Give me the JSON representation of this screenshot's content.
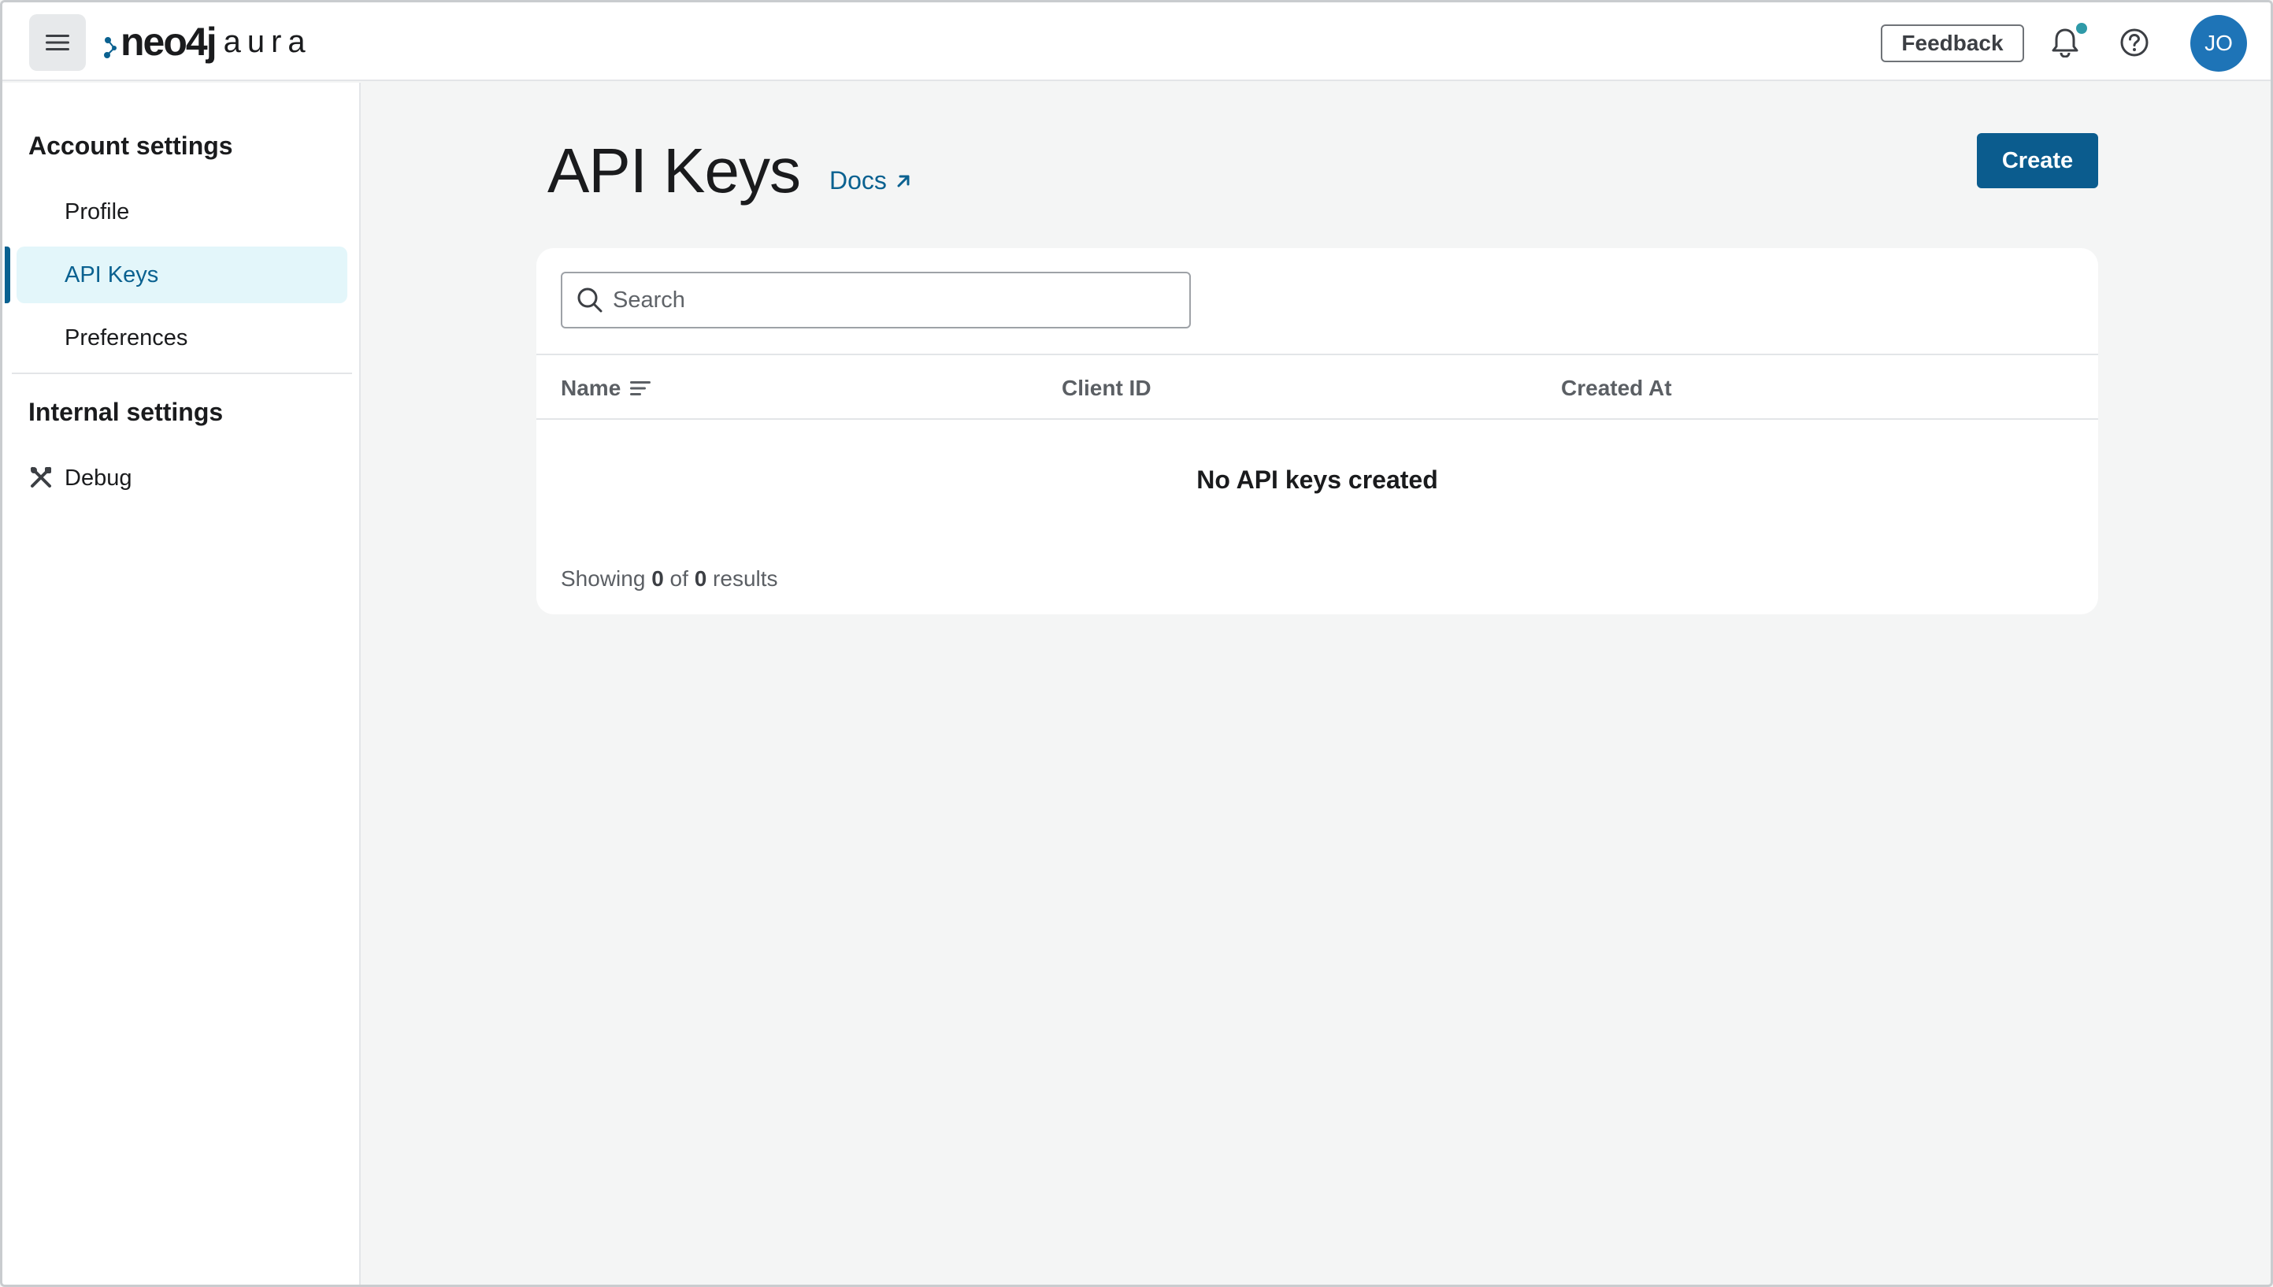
{
  "topbar": {
    "logo_main": "neo4j",
    "logo_sub": "aura",
    "feedback_label": "Feedback",
    "avatar_initials": "JO",
    "notification_dot_color": "#2f9aa8"
  },
  "sidebar": {
    "account_title": "Account settings",
    "items": [
      {
        "label": "Profile",
        "active": false
      },
      {
        "label": "API Keys",
        "active": true
      },
      {
        "label": "Preferences",
        "active": false
      }
    ],
    "internal_title": "Internal settings",
    "debug_label": "Debug"
  },
  "main": {
    "title": "API Keys",
    "docs_label": "Docs",
    "create_label": "Create",
    "search_placeholder": "Search",
    "columns": [
      "Name",
      "Client ID",
      "Created At"
    ],
    "empty_message": "No API keys created",
    "results": {
      "prefix": "Showing",
      "shown": "0",
      "middle": "of",
      "total": "0",
      "suffix": "results"
    }
  },
  "colors": {
    "accent": "#0b5c8e",
    "link": "#0a6190",
    "active_bg": "#e3f6fa",
    "avatar_bg": "#1e74b7"
  }
}
